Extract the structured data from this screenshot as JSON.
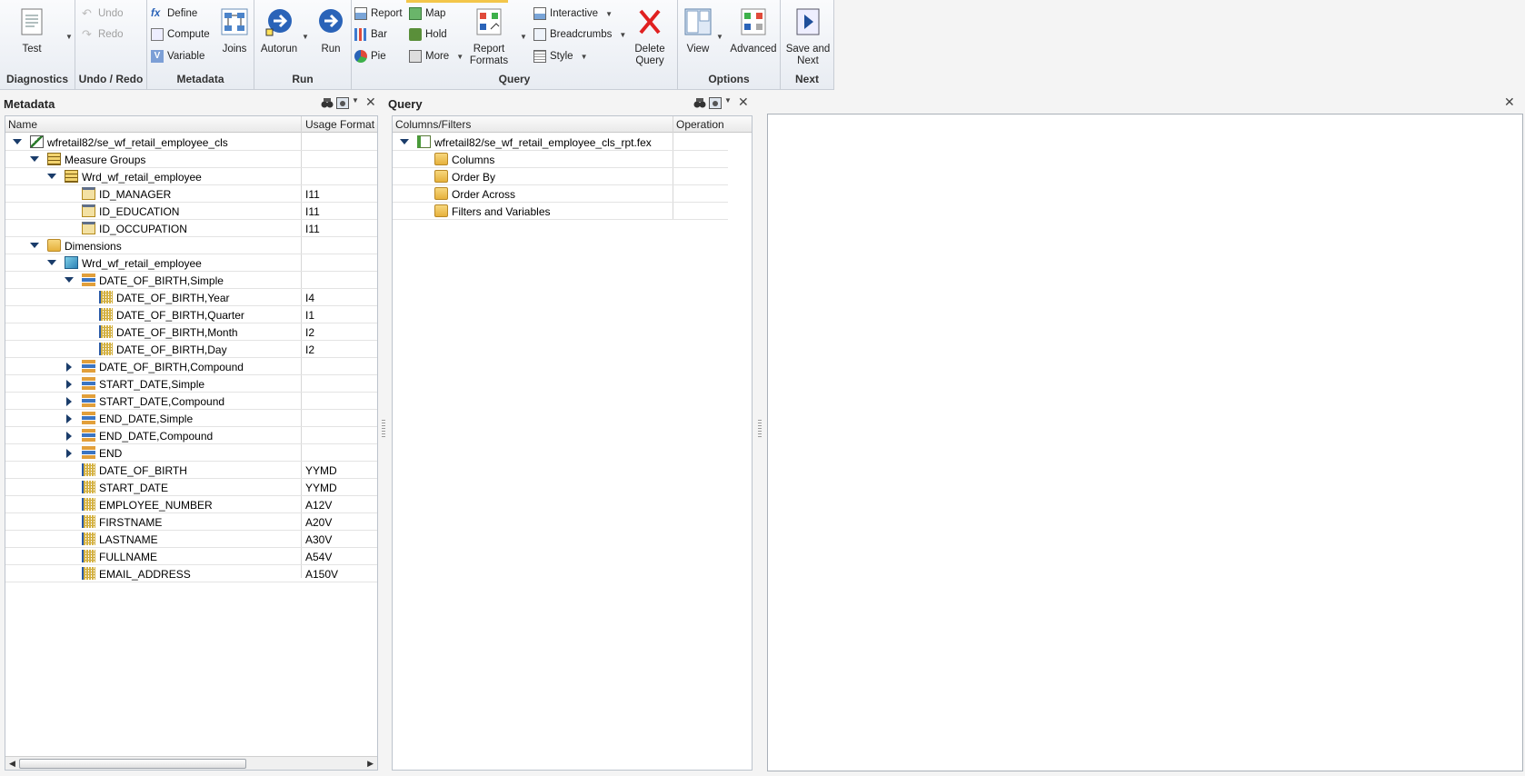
{
  "ribbon": {
    "groups": {
      "diagnostics": "Diagnostics",
      "undo_redo": "Undo / Redo",
      "metadata": "Metadata",
      "run": "Run",
      "query": "Query",
      "options": "Options",
      "next": "Next"
    },
    "buttons": {
      "test": "Test",
      "undo": "Undo",
      "redo": "Redo",
      "define": "Define",
      "compute": "Compute",
      "variable": "Variable",
      "joins": "Joins",
      "autorun": "Autorun",
      "run": "Run",
      "report": "Report",
      "bar": "Bar",
      "pie": "Pie",
      "map": "Map",
      "hold": "Hold",
      "more": "More",
      "report_formats_1": "Report",
      "report_formats_2": "Formats",
      "interactive": "Interactive",
      "breadcrumbs": "Breadcrumbs",
      "style": "Style",
      "delete_query_1": "Delete",
      "delete_query_2": "Query",
      "view": "View",
      "advanced": "Advanced",
      "save_next_1": "Save and",
      "save_next_2": "Next"
    }
  },
  "metadata_panel": {
    "title": "Metadata",
    "col_name": "Name",
    "col_usage": "Usage Format",
    "rows": [
      {
        "label": "wfretail82/se_wf_retail_employee_cls",
        "fmt": "",
        "level": 0,
        "twisty": "open",
        "icon": "source-icon"
      },
      {
        "label": "Measure Groups",
        "fmt": "",
        "level": 1,
        "twisty": "open",
        "icon": "measure-groups-icon"
      },
      {
        "label": "Wrd_wf_retail_employee",
        "fmt": "",
        "level": 2,
        "twisty": "open",
        "icon": "measure-group-icon"
      },
      {
        "label": "ID_MANAGER",
        "fmt": "I11",
        "level": 3,
        "twisty": "",
        "icon": "measure-icon"
      },
      {
        "label": "ID_EDUCATION",
        "fmt": "I11",
        "level": 3,
        "twisty": "",
        "icon": "measure-icon"
      },
      {
        "label": "ID_OCCUPATION",
        "fmt": "I11",
        "level": 3,
        "twisty": "",
        "icon": "measure-icon"
      },
      {
        "label": "Dimensions",
        "fmt": "",
        "level": 1,
        "twisty": "open",
        "icon": "folder-icon"
      },
      {
        "label": "Wrd_wf_retail_employee",
        "fmt": "",
        "level": 2,
        "twisty": "open",
        "icon": "cube-icon"
      },
      {
        "label": "DATE_OF_BIRTH,Simple",
        "fmt": "",
        "level": 3,
        "twisty": "open",
        "icon": "hierarchy-icon"
      },
      {
        "label": "DATE_OF_BIRTH,Year",
        "fmt": "I4",
        "level": 4,
        "twisty": "",
        "icon": "field-icon"
      },
      {
        "label": "DATE_OF_BIRTH,Quarter",
        "fmt": "I1",
        "level": 4,
        "twisty": "",
        "icon": "field-icon"
      },
      {
        "label": "DATE_OF_BIRTH,Month",
        "fmt": "I2",
        "level": 4,
        "twisty": "",
        "icon": "field-icon"
      },
      {
        "label": "DATE_OF_BIRTH,Day",
        "fmt": "I2",
        "level": 4,
        "twisty": "",
        "icon": "field-icon"
      },
      {
        "label": "DATE_OF_BIRTH,Compound",
        "fmt": "",
        "level": 3,
        "twisty": "closed",
        "icon": "hierarchy-icon"
      },
      {
        "label": "START_DATE,Simple",
        "fmt": "",
        "level": 3,
        "twisty": "closed",
        "icon": "hierarchy-icon"
      },
      {
        "label": "START_DATE,Compound",
        "fmt": "",
        "level": 3,
        "twisty": "closed",
        "icon": "hierarchy-icon"
      },
      {
        "label": "END_DATE,Simple",
        "fmt": "",
        "level": 3,
        "twisty": "closed",
        "icon": "hierarchy-icon"
      },
      {
        "label": "END_DATE,Compound",
        "fmt": "",
        "level": 3,
        "twisty": "closed",
        "icon": "hierarchy-icon"
      },
      {
        "label": "END",
        "fmt": "",
        "level": 3,
        "twisty": "closed",
        "icon": "hierarchy-icon"
      },
      {
        "label": "DATE_OF_BIRTH",
        "fmt": "YYMD",
        "level": 3,
        "twisty": "",
        "icon": "field-icon"
      },
      {
        "label": "START_DATE",
        "fmt": "YYMD",
        "level": 3,
        "twisty": "",
        "icon": "field-icon"
      },
      {
        "label": "EMPLOYEE_NUMBER",
        "fmt": "A12V",
        "level": 3,
        "twisty": "",
        "icon": "field-icon"
      },
      {
        "label": "FIRSTNAME",
        "fmt": "A20V",
        "level": 3,
        "twisty": "",
        "icon": "field-icon"
      },
      {
        "label": "LASTNAME",
        "fmt": "A30V",
        "level": 3,
        "twisty": "",
        "icon": "field-icon"
      },
      {
        "label": "FULLNAME",
        "fmt": "A54V",
        "level": 3,
        "twisty": "",
        "icon": "field-icon"
      },
      {
        "label": "EMAIL_ADDRESS",
        "fmt": "A150V",
        "level": 3,
        "twisty": "",
        "icon": "field-icon"
      }
    ]
  },
  "query_panel": {
    "title": "Query",
    "col_name": "Columns/Filters",
    "col_op": "Operation",
    "rows": [
      {
        "label": "wfretail82/se_wf_retail_employee_cls_rpt.fex",
        "level": 0,
        "twisty": "open",
        "icon": "report-icon"
      },
      {
        "label": "Columns",
        "level": 1,
        "twisty": "",
        "icon": "folder-icon"
      },
      {
        "label": "Order By",
        "level": 1,
        "twisty": "",
        "icon": "folder-icon"
      },
      {
        "label": "Order Across",
        "level": 1,
        "twisty": "",
        "icon": "folder-icon"
      },
      {
        "label": "Filters and Variables",
        "level": 1,
        "twisty": "",
        "icon": "folder-icon"
      }
    ]
  },
  "colors": {
    "accent": "#f3c64a",
    "twisty": "#1a3c6a",
    "run_blue": "#2a63b8"
  }
}
